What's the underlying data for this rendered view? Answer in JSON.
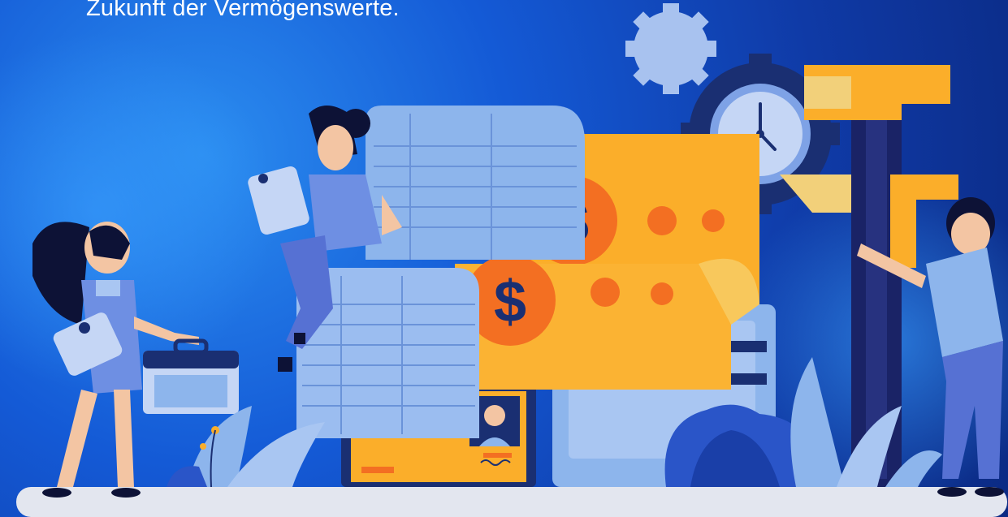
{
  "header": {
    "tagline": "Zukunft der Vermögenswerte."
  },
  "illustration": {
    "currency_symbols": [
      "$",
      "$"
    ],
    "clock": {
      "hour_hand": "up",
      "minute_hand": "down-right"
    }
  },
  "colors": {
    "background_dark": "#0b2a83",
    "background_light": "#2b8df0",
    "money_orange": "#fbae2a",
    "money_dark_orange": "#f36f22",
    "document_blue": "#8db5ec",
    "figure_blue": "#6e8fe3",
    "floor": "#e3e6ef"
  },
  "icons": [
    "gear-icon",
    "clock-icon",
    "dollar-icon",
    "briefcase-icon",
    "tablet-icon",
    "id-card-icon",
    "caliper-icon"
  ]
}
